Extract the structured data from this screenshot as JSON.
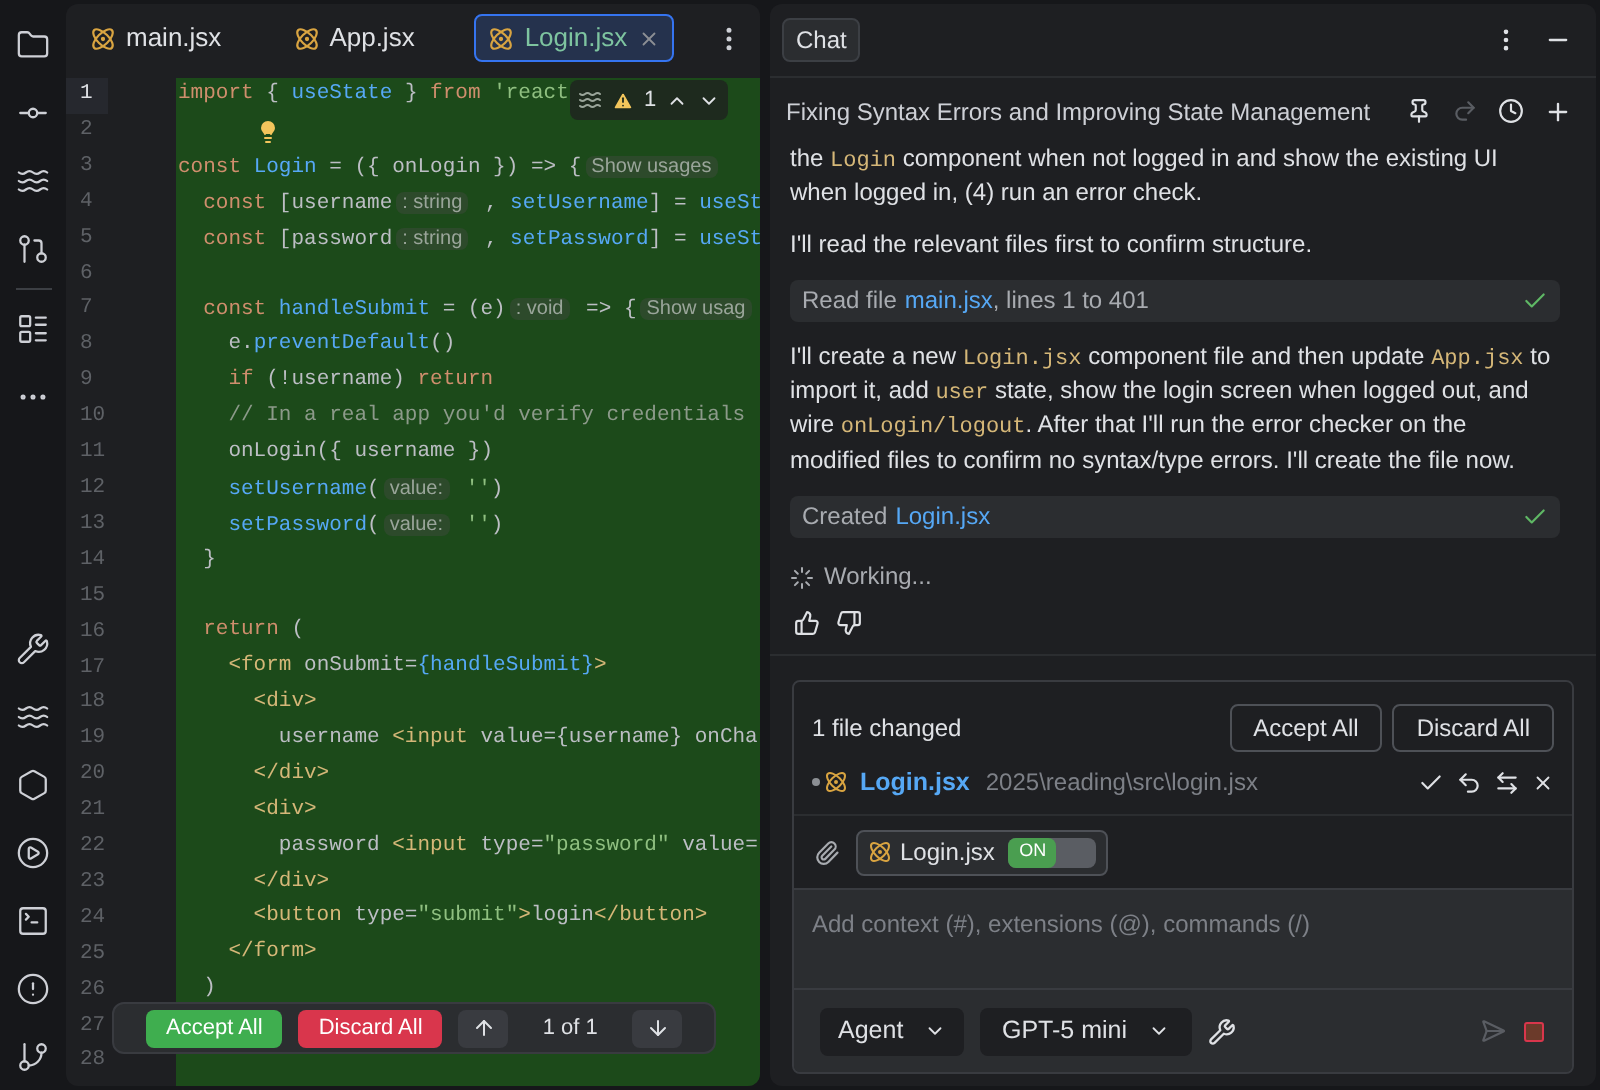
{
  "editor": {
    "tabs": [
      {
        "label": "main.jsx",
        "selected": false
      },
      {
        "label": "App.jsx",
        "selected": false
      },
      {
        "label": "Login.jsx",
        "selected": true
      }
    ],
    "problems": {
      "count": "1"
    },
    "lines": [
      {
        "number": "1",
        "current": true,
        "segments": [
          {
            "kind": "keyword",
            "text": "import"
          },
          {
            "kind": "plain",
            "text": " { "
          },
          {
            "kind": "function",
            "text": "useState"
          },
          {
            "kind": "plain",
            "text": " } "
          },
          {
            "kind": "keyword",
            "text": "from"
          },
          {
            "kind": "string",
            "text": " 'react"
          }
        ]
      },
      {
        "number": "2",
        "current": false
      },
      {
        "number": "3",
        "current": false,
        "segments": [
          {
            "kind": "keyword",
            "text": "const"
          },
          {
            "kind": "function",
            "text": " Login"
          },
          {
            "kind": "plain",
            "text": " = ({ onLogin }) => {"
          },
          {
            "kind": "hint",
            "text": "Show usages"
          }
        ]
      },
      {
        "number": "4",
        "current": false,
        "segments": [
          {
            "kind": "keyword",
            "text": "  const"
          },
          {
            "kind": "plain",
            "text": " [username"
          },
          {
            "kind": "hint",
            "text": ": string"
          },
          {
            "kind": "plain",
            "text": " , "
          },
          {
            "kind": "function",
            "text": "setUsername"
          },
          {
            "kind": "plain",
            "text": "] = "
          },
          {
            "kind": "function",
            "text": "useSt"
          }
        ]
      },
      {
        "number": "5",
        "current": false,
        "segments": [
          {
            "kind": "keyword",
            "text": "  const"
          },
          {
            "kind": "plain",
            "text": " [password"
          },
          {
            "kind": "hint",
            "text": ": string"
          },
          {
            "kind": "plain",
            "text": " , "
          },
          {
            "kind": "function",
            "text": "setPassword"
          },
          {
            "kind": "plain",
            "text": "] = "
          },
          {
            "kind": "function",
            "text": "useSt"
          }
        ]
      },
      {
        "number": "6",
        "current": false
      },
      {
        "number": "7",
        "current": false,
        "segments": [
          {
            "kind": "keyword",
            "text": "  const"
          },
          {
            "kind": "function",
            "text": " handleSubmit"
          },
          {
            "kind": "plain",
            "text": " = (e)"
          },
          {
            "kind": "hint",
            "text": ": void"
          },
          {
            "kind": "plain",
            "text": " => {"
          },
          {
            "kind": "hint",
            "text": "Show usag"
          }
        ]
      },
      {
        "number": "8",
        "current": false,
        "segments": [
          {
            "kind": "plain",
            "text": "    e."
          },
          {
            "kind": "function",
            "text": "preventDefault"
          },
          {
            "kind": "plain",
            "text": "()"
          }
        ]
      },
      {
        "number": "9",
        "current": false,
        "segments": [
          {
            "kind": "keyword",
            "text": "    if"
          },
          {
            "kind": "plain",
            "text": " (!username) "
          },
          {
            "kind": "keyword",
            "text": "return"
          }
        ]
      },
      {
        "number": "10",
        "current": false,
        "segments": [
          {
            "kind": "comment",
            "text": "    // In a real app you'd verify credentials"
          }
        ]
      },
      {
        "number": "11",
        "current": false,
        "segments": [
          {
            "kind": "plain",
            "text": "    onLogin({ username })"
          }
        ]
      },
      {
        "number": "12",
        "current": false,
        "segments": [
          {
            "kind": "function",
            "text": "    setUsername"
          },
          {
            "kind": "plain",
            "text": "("
          },
          {
            "kind": "hint",
            "text": "value:"
          },
          {
            "kind": "string",
            "text": " ''"
          },
          {
            "kind": "plain",
            "text": ")"
          }
        ]
      },
      {
        "number": "13",
        "current": false,
        "segments": [
          {
            "kind": "function",
            "text": "    setPassword"
          },
          {
            "kind": "plain",
            "text": "("
          },
          {
            "kind": "hint",
            "text": "value:"
          },
          {
            "kind": "string",
            "text": " ''"
          },
          {
            "kind": "plain",
            "text": ")"
          }
        ]
      },
      {
        "number": "14",
        "current": false,
        "segments": [
          {
            "kind": "plain",
            "text": "  }"
          }
        ]
      },
      {
        "number": "15",
        "current": false
      },
      {
        "number": "16",
        "current": false,
        "segments": [
          {
            "kind": "keyword",
            "text": "  return"
          },
          {
            "kind": "plain",
            "text": " ("
          }
        ]
      },
      {
        "number": "17",
        "current": false,
        "segments": [
          {
            "kind": "tag",
            "text": "    <form"
          },
          {
            "kind": "plain",
            "text": " onSubmit="
          },
          {
            "kind": "function",
            "text": "{handleSubmit}"
          },
          {
            "kind": "tag",
            "text": ">"
          }
        ]
      },
      {
        "number": "18",
        "current": false,
        "segments": [
          {
            "kind": "tag",
            "text": "      <div>"
          }
        ]
      },
      {
        "number": "19",
        "current": false,
        "segments": [
          {
            "kind": "plain",
            "text": "        username "
          },
          {
            "kind": "tag",
            "text": "<input"
          },
          {
            "kind": "plain",
            "text": " value={username} onCha"
          }
        ]
      },
      {
        "number": "20",
        "current": false,
        "segments": [
          {
            "kind": "tag",
            "text": "      </div>"
          }
        ]
      },
      {
        "number": "21",
        "current": false,
        "segments": [
          {
            "kind": "tag",
            "text": "      <div>"
          }
        ]
      },
      {
        "number": "22",
        "current": false,
        "segments": [
          {
            "kind": "plain",
            "text": "        password "
          },
          {
            "kind": "tag",
            "text": "<input"
          },
          {
            "kind": "plain",
            "text": " type="
          },
          {
            "kind": "string",
            "text": "\"password\""
          },
          {
            "kind": "plain",
            "text": " value="
          }
        ]
      },
      {
        "number": "23",
        "current": false,
        "segments": [
          {
            "kind": "tag",
            "text": "      </div>"
          }
        ]
      },
      {
        "number": "24",
        "current": false,
        "segments": [
          {
            "kind": "tag",
            "text": "      <button"
          },
          {
            "kind": "plain",
            "text": " type="
          },
          {
            "kind": "string",
            "text": "\"submit\""
          },
          {
            "kind": "tag",
            "text": ">"
          },
          {
            "kind": "plain",
            "text": "login"
          },
          {
            "kind": "tag",
            "text": "</button>"
          }
        ]
      },
      {
        "number": "25",
        "current": false,
        "segments": [
          {
            "kind": "tag",
            "text": "    </form>"
          }
        ]
      },
      {
        "number": "26",
        "current": false,
        "segments": [
          {
            "kind": "plain",
            "text": "  )"
          }
        ]
      },
      {
        "number": "27",
        "current": false
      },
      {
        "number": "28",
        "current": false
      }
    ],
    "diff_toolbar": {
      "accept": "Accept All",
      "discard": "Discard All",
      "position": "1 of 1"
    }
  },
  "chat": {
    "tab": "Chat",
    "title": "Fixing Syntax Errors and Improving State Management",
    "messages": [
      {
        "kind": "text",
        "parts": [
          {
            "kind": "text",
            "text": "the "
          },
          {
            "kind": "code",
            "text": "Login"
          },
          {
            "kind": "text",
            "text": " component when not logged in and show the existing UI when logged in, (4) run an error check."
          }
        ]
      },
      {
        "kind": "text",
        "parts": [
          {
            "kind": "text",
            "text": "I'll read the relevant files first to confirm structure."
          }
        ]
      },
      {
        "kind": "tool",
        "label": "Read file",
        "file": "main.jsx",
        "detail": ", lines 1 to 401",
        "done": true
      },
      {
        "kind": "text",
        "parts": [
          {
            "kind": "text",
            "text": "I'll create a new "
          },
          {
            "kind": "code",
            "text": "Login.jsx"
          },
          {
            "kind": "text",
            "text": " component file and then update "
          },
          {
            "kind": "code",
            "text": "App.jsx"
          },
          {
            "kind": "text",
            "text": " to import it, add "
          },
          {
            "kind": "code",
            "text": "user"
          },
          {
            "kind": "text",
            "text": " state, show the login screen when logged out, and wire "
          },
          {
            "kind": "code",
            "text": "onLogin/logout"
          },
          {
            "kind": "text",
            "text": ". After that I'll run the error checker on the modified files to confirm no syntax/type errors. I'll create the file now."
          }
        ]
      },
      {
        "kind": "tool",
        "label": "Created",
        "file": "Login.jsx",
        "done": true
      }
    ],
    "status": "Working...",
    "changes": {
      "summary": "1 file changed",
      "accept": "Accept All",
      "discard": "Discard All",
      "files": [
        {
          "name": "Login.jsx",
          "path": "2025\\reading\\src\\login.jsx"
        }
      ]
    },
    "context": [
      {
        "name": "Login.jsx",
        "on": true,
        "toggle_label": "ON"
      }
    ],
    "input": {
      "placeholder": "Add context (#), extensions (@), commands (/)"
    },
    "mode": "Agent",
    "model": "GPT-5 mini"
  }
}
